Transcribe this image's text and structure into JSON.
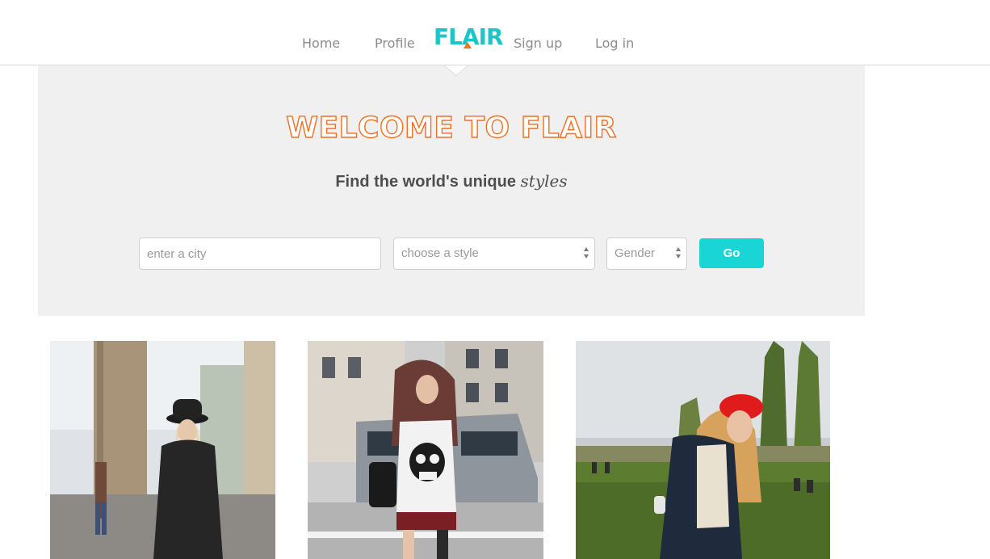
{
  "nav": {
    "home": "Home",
    "profile": "Profile",
    "logo": "FLAIR",
    "signup": "Sign up",
    "login": "Log in"
  },
  "hero": {
    "title": "WELCOME TO FLAIR",
    "subtitle_main": "Find the world's unique",
    "subtitle_accent": "styles"
  },
  "search": {
    "city_placeholder": "enter a city",
    "style_value": "choose a style",
    "gender_value": "Gender",
    "go_label": "Go"
  },
  "colors": {
    "brand_teal": "#1ac6c8",
    "brand_orange": "#f37021",
    "hero_bg": "#f0f0f0",
    "button": "#1ad5d6"
  },
  "photos": [
    {
      "subject": "street-style-photo-hat"
    },
    {
      "subject": "street-style-photo-skull-top"
    },
    {
      "subject": "street-style-photo-red-beret"
    }
  ]
}
